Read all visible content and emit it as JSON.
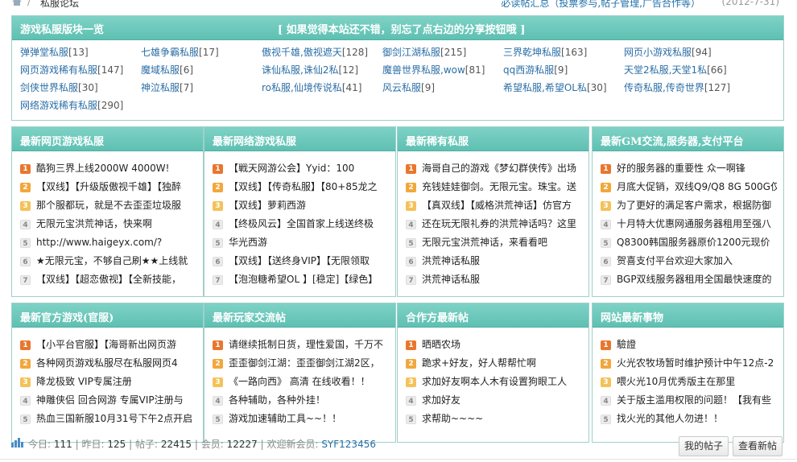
{
  "breadcrumb": {
    "home_icon": "home-icon",
    "current": "私服论坛"
  },
  "notice": {
    "text": "必读帖汇总（投票参与,帖子管理,广告合作等）",
    "date": "(2012-7-31)"
  },
  "board_panel": {
    "title": "游戏私服版块一览",
    "slogan": "[ 如果觉得本站还不错，别忘了点右边的分享按钮哦 ]",
    "forums": [
      {
        "name": "弹弹堂私服",
        "count": "[13]"
      },
      {
        "name": "七雄争霸私服",
        "count": "[17]"
      },
      {
        "name": "傲视千雄,傲视遮天",
        "count": "[128]"
      },
      {
        "name": "御剑江湖私服",
        "count": "[215]"
      },
      {
        "name": "三界乾坤私服",
        "count": "[163]"
      },
      {
        "name": "网页小游戏私服",
        "count": "[94]"
      },
      {
        "name": "网页游戏稀有私服",
        "count": "[147]"
      },
      {
        "name": "魔域私服",
        "count": "[6]"
      },
      {
        "name": "诛仙私服,诛仙2私",
        "count": "[12]"
      },
      {
        "name": "魔兽世界私服,wow",
        "count": "[81]"
      },
      {
        "name": "qq西游私服",
        "count": "[9]"
      },
      {
        "name": "天堂2私服,天堂1私",
        "count": "[66]"
      },
      {
        "name": "剑侠世界私服",
        "count": "[30]"
      },
      {
        "name": "神泣私服",
        "count": "[7]"
      },
      {
        "name": "ro私服,仙境传说私",
        "count": "[41]"
      },
      {
        "name": "风云私服",
        "count": "[9]"
      },
      {
        "name": "希望私服,希望OL私",
        "count": "[30]"
      },
      {
        "name": "传奇私服,传奇世界",
        "count": "[127]"
      },
      {
        "name": "网络游戏稀有私服",
        "count": "[290]"
      }
    ]
  },
  "boxes_row1": [
    {
      "title": "最新网页游戏私服",
      "items": [
        "酷狗三界上线2000W 4000W!",
        "【双线】【升级版傲视千雄】【独醉",
        "那个服都玩，就是不去歪歪垃圾服",
        "无限元宝洪荒神话，快来啊",
        "http://www.haigeyx.com/?",
        "★无限元宝，不够自己刷★★上线就",
        "【双线】【超恋傲视】【全新技能，"
      ]
    },
    {
      "title": "最新网络游戏私服",
      "items": [
        "【戦天网游公会】Yyid：100",
        "【双线】【传奇私服】【80+85龙之",
        "【双线】萝莉西游",
        "【终极风云】全国首家上线送终极",
        "华光西游",
        "【双线】【送终身VIP】【无限领取",
        "【泡泡糖希望OL 】[稳定]【绿色】"
      ]
    },
    {
      "title": "最新稀有私服",
      "items": [
        "海哥自己的游戏《梦幻群侠传》出场",
        "充钱娃娃御剑。无限元宝。珠宝。送",
        "【真双线】【威格洪荒神话】仿官方",
        "还在玩无限礼券的洪荒神话吗？这里",
        "无限元宝洪荒神话，来看看吧",
        "洪荒神话私服",
        "洪荒神话私服"
      ]
    },
    {
      "title": "最新GM交流,服务器,支付平台",
      "items": [
        "好的服务器的重要性 众一啊锋",
        "月底大促销，双线Q9/Q8 8G 500G仅",
        "为了更好的满足客户需求，根据防御",
        "十月特大优惠网通服务器租用至强八",
        "Q8300韩国服务器原价1200元现价",
        "贺喜支付平台欢迎大家加入",
        "BGP双线服务器租用全国最快速度的"
      ]
    }
  ],
  "boxes_row2": [
    {
      "title": "最新官方游戏(官服)",
      "items": [
        "【小平台官服】【海哥新出网页游",
        "各种网页游戏私服尽在私服网页4",
        "降龙极致 VIP专属注册",
        "神雕侠侣 回合网游 专属VIP注册与",
        "热血三国新服10月31号下午2点开启"
      ]
    },
    {
      "title": "最新玩家交流帖",
      "items": [
        "请继续抵制日货，理性爱国，千万不",
        "歪歪御剑江湖：歪歪御剑江湖2区，",
        "《一路向西》 高清 在线收看！！",
        "各种辅助，各种外挂！",
        "游戏加速辅助工具~~！！"
      ]
    },
    {
      "title": "合作方最新帖",
      "items": [
        "晒晒农场",
        "跪求+好友，好人帮帮忙啊",
        "求加好友啊本人木有设置狗眼工人",
        "求加好友",
        "求帮助~~~~"
      ]
    },
    {
      "title": "网站最新事物",
      "items": [
        "驗證",
        "火光农牧场暂时维护预计中午12点-2",
        "喂火光10月优秀版主在那里",
        "关于版主滥用权限的问题！【我有些",
        "找火光的其他人勿进！！"
      ]
    }
  ],
  "stats": {
    "icon": "stats-icon",
    "today_label": "今日:",
    "today": "111",
    "yesterday_label": "昨日:",
    "yesterday": "125",
    "posts_label": "帖子:",
    "posts": "22415",
    "members_label": "会员:",
    "members": "12227",
    "welcome_label": "欢迎新会员:",
    "new_member": "SYF123456"
  },
  "buttons": {
    "my_posts": "我的帖子",
    "view_new": "查看新帖"
  },
  "colors": {
    "accent": "#5ec0b2",
    "link": "#2b6ea6"
  }
}
